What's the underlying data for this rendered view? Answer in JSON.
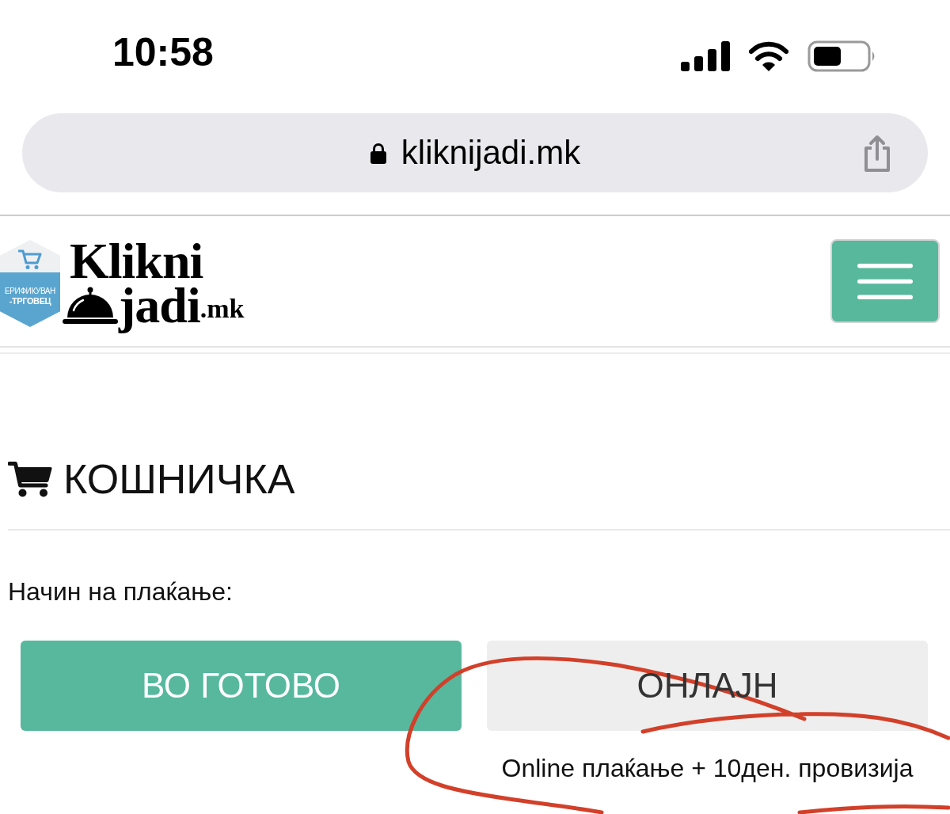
{
  "status_bar": {
    "time": "10:58"
  },
  "browser": {
    "url": "kliknijadi.mk"
  },
  "header": {
    "badge": {
      "lines": [
        "ЕРИФИКУВАН",
        "-ТРГОВЕЦ"
      ]
    },
    "logo": {
      "line_1": "Klikni",
      "line_2": "jadi",
      "suffix": ".mk"
    }
  },
  "cart": {
    "title": "КОШНИЧКА",
    "payment_label": "Начин на плаќање:",
    "payment_options": [
      {
        "label": "ВО ГОТОВО",
        "selected": true
      },
      {
        "label": "ОНЛАЈН",
        "selected": false,
        "note": "Online плаќање + 10ден. провизија"
      }
    ]
  },
  "annotations": [
    {
      "kind": "loop"
    }
  ]
}
